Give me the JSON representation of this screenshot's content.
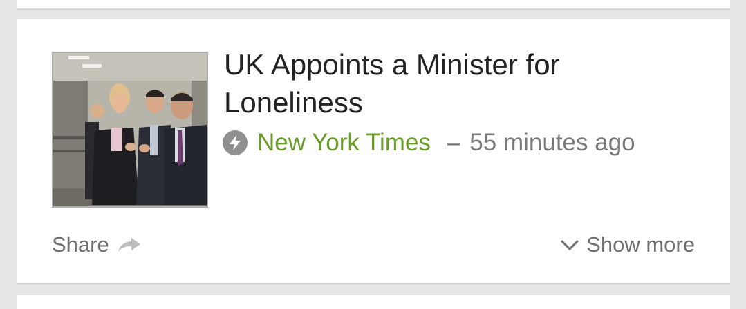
{
  "article": {
    "title": "UK Appoints a Minister for Loneliness",
    "source": "New York Times",
    "separator": "–",
    "time_ago": "55 minutes ago",
    "thumbnail_alt": "photo"
  },
  "actions": {
    "share_label": "Share",
    "show_more_label": "Show more"
  },
  "icons": {
    "source_icon": "bolt-icon",
    "share_icon": "share-arrow-icon",
    "expand_icon": "chevron-down-icon"
  },
  "colors": {
    "source_green": "#6a9e2a",
    "icon_gray": "#909090",
    "background": "#e6e6e6"
  }
}
